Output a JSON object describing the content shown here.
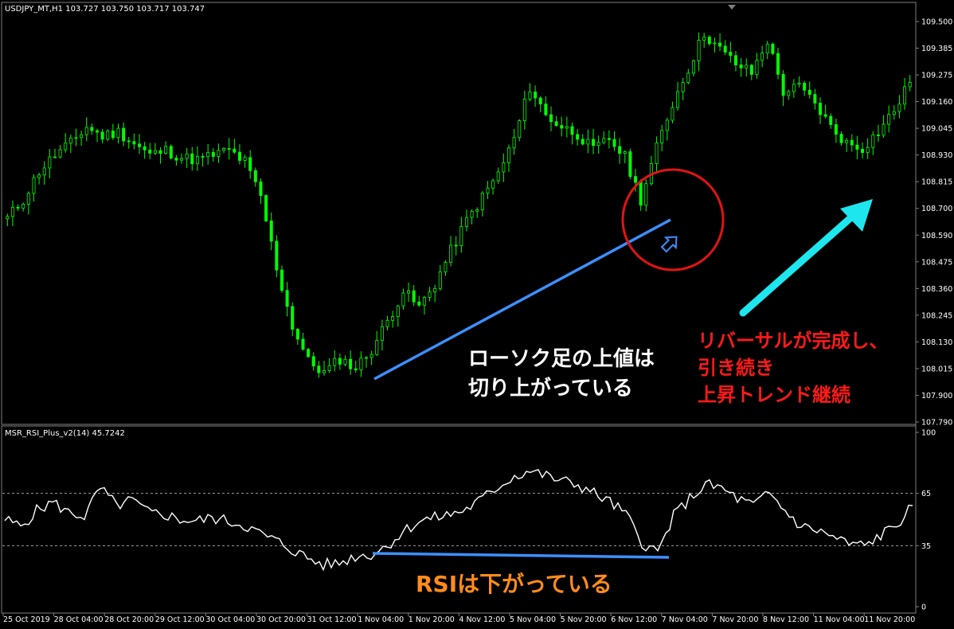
{
  "main_chart": {
    "header": "USDJPY_MT,H1  103.727 103.750 103.717 103.747",
    "y_ticks": [
      "109.500",
      "109.385",
      "109.275",
      "109.160",
      "109.045",
      "108.930",
      "108.815",
      "108.700",
      "108.590",
      "108.475",
      "108.360",
      "108.245",
      "108.130",
      "108.015",
      "107.900",
      "107.790"
    ],
    "colors": {
      "candle": "#00ff00",
      "background": "#000000",
      "axis_text": "#ffffff",
      "grid": "#808080"
    }
  },
  "indicator": {
    "header": "MSR_RSI_Plus_v2(14) 45.7242",
    "levels": [
      "100",
      "65",
      "35",
      "0"
    ],
    "line_color": "#ffffff"
  },
  "x_axis": {
    "labels": [
      "25 Oct 2019",
      "28 Oct 04:00",
      "28 Oct 20:00",
      "29 Oct 12:00",
      "30 Oct 04:00",
      "30 Oct 20:00",
      "31 Oct 12:00",
      "1 Nov 04:00",
      "1 Nov 20:00",
      "4 Nov 12:00",
      "5 Nov 04:00",
      "5 Nov 20:00",
      "6 Nov 12:00",
      "7 Nov 04:00",
      "7 Nov 20:00",
      "8 Nov 12:00",
      "11 Nov 04:00",
      "11 Nov 20:00"
    ]
  },
  "annotations": {
    "white_text": [
      "ローソク足の上値は",
      "切り上がっている"
    ],
    "red_text": [
      "リバーサルが完成し、",
      "引き続き",
      "上昇トレンド継続"
    ],
    "orange_text": "RSIは下がっている",
    "colors": {
      "white": "#ffffff",
      "red": "#ff1a1a",
      "orange": "#ff8c1a",
      "blue_line": "#3d8fff",
      "cyan_arrow": "#1ee6ee",
      "circle": "#e01414"
    }
  },
  "chart_data": {
    "type": "candlestick",
    "price_series": {
      "name": "USDJPY_MT,H1",
      "close": [
        108.66,
        108.74,
        108.86,
        108.93,
        108.98,
        109.05,
        109.01,
        109.03,
        108.98,
        108.93,
        108.95,
        108.92,
        108.91,
        108.93,
        108.95,
        108.9,
        108.75,
        108.45,
        108.2,
        108.05,
        108.0,
        108.06,
        108.02,
        108.1,
        108.22,
        108.35,
        108.28,
        108.38,
        108.52,
        108.65,
        108.75,
        108.85,
        109.0,
        109.22,
        109.1,
        109.05,
        109.02,
        108.95,
        109.0,
        108.92,
        108.74,
        108.96,
        109.15,
        109.3,
        109.45,
        109.38,
        109.32,
        109.28,
        109.42,
        109.2,
        109.22,
        109.15,
        109.05,
        108.98,
        108.96,
        109.03,
        109.12,
        109.24
      ]
    },
    "rsi_series": {
      "name": "MSR_RSI_Plus_v2(14)",
      "values": [
        50,
        46,
        55,
        60,
        54,
        52,
        68,
        58,
        61,
        54,
        53,
        50,
        49,
        51,
        49,
        47,
        42,
        38,
        33,
        28,
        24,
        25,
        29,
        30,
        35,
        43,
        49,
        51,
        53,
        56,
        62,
        69,
        75,
        78,
        75,
        72,
        70,
        65,
        60,
        53,
        37,
        31,
        52,
        62,
        70,
        68,
        62,
        58,
        65,
        55,
        46,
        44,
        40,
        36,
        35,
        41,
        47,
        58
      ]
    },
    "rsi_levels": [
      65,
      35
    ],
    "ylim_price": [
      107.79,
      109.5
    ],
    "ylim_rsi": [
      0,
      100
    ],
    "last_price": 103.747,
    "last_rsi": 45.7242
  }
}
